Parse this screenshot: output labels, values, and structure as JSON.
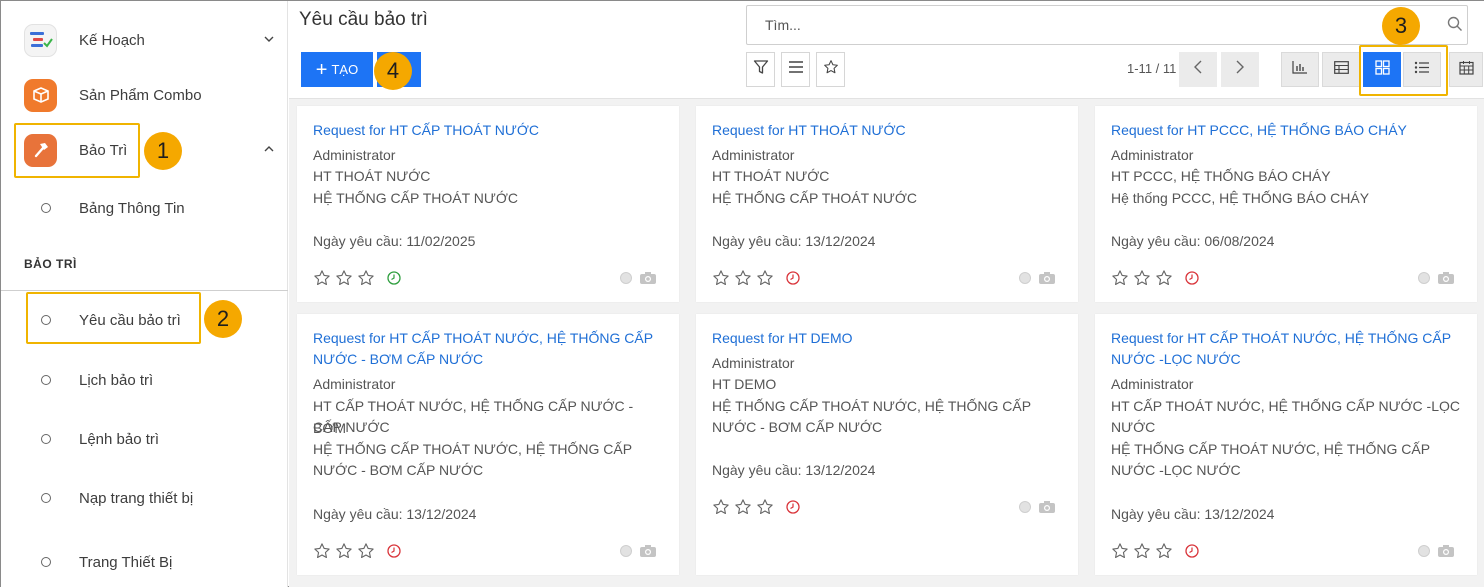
{
  "sidebar": {
    "apps": [
      {
        "label": "Kế Hoạch",
        "icon": "plan-chart-icon"
      },
      {
        "label": "Sản Phẩm Combo",
        "icon": "combo-box-icon"
      },
      {
        "label": "Bảo Trì",
        "icon": "hammer-icon"
      }
    ],
    "maintenance_sub": {
      "label": "Bảng Thông Tin"
    },
    "section_header": "BẢO TRÌ",
    "items": [
      {
        "label": "Yêu cầu bảo trì"
      },
      {
        "label": "Lịch bảo trì"
      },
      {
        "label": "Lệnh bảo trì"
      },
      {
        "label": "Nạp trang thiết bị"
      },
      {
        "label": "Trang Thiết Bị"
      }
    ]
  },
  "badges": {
    "b1": "1",
    "b2": "2",
    "b3": "3",
    "b4": "4"
  },
  "header": {
    "title": "Yêu cầu bảo trì",
    "search_placeholder": "Tìm...",
    "create_label": "TẠO",
    "pager": "1-11 / 11"
  },
  "colors": {
    "accent": "#1d74f5",
    "highlight": "#f0b400",
    "badge": "#f5a800",
    "clock_green": "#2e9e3e",
    "clock_red": "#d9343a"
  },
  "cards": [
    {
      "title": "Request for HT CẤP THOÁT NƯỚC",
      "lines": [
        "Administrator",
        "HT THOÁT NƯỚC",
        "HỆ THỐNG CẤP THOÁT NƯỚC"
      ],
      "date": "Ngày yêu cầu: 11/02/2025",
      "clock": "green"
    },
    {
      "title": "Request for HT THOÁT NƯỚC",
      "lines": [
        "Administrator",
        "HT THOÁT NƯỚC",
        "HỆ THỐNG CẤP THOÁT NƯỚC"
      ],
      "date": "Ngày yêu cầu: 13/12/2024",
      "clock": "red"
    },
    {
      "title": "Request for HT PCCC, HỆ THỐNG BÁO CHÁY",
      "lines": [
        "Administrator",
        "HT PCCC, HỆ THỐNG BÁO CHÁY",
        "Hệ thống PCCC, HỆ THỐNG BÁO CHÁY"
      ],
      "date": "Ngày yêu cầu: 06/08/2024",
      "clock": "red"
    },
    {
      "title_lines": [
        "Request for HT CẤP THOÁT NƯỚC, HỆ THỐNG CẤP",
        "NƯỚC - BƠM CẤP NƯỚC"
      ],
      "lines": [
        "Administrator",
        "HT CẤP THOÁT NƯỚC, HỆ THỐNG CẤP NƯỚC - BƠM",
        "CẤP NƯỚC",
        "HỆ THỐNG CẤP THOÁT NƯỚC, HỆ THỐNG CẤP",
        "NƯỚC - BƠM CẤP NƯỚC"
      ],
      "date": "Ngày yêu cầu: 13/12/2024",
      "clock": "red"
    },
    {
      "title": "Request for HT DEMO",
      "lines": [
        "Administrator",
        "HT DEMO",
        "HỆ THỐNG CẤP THOÁT NƯỚC, HỆ THỐNG CẤP",
        "NƯỚC - BƠM CẤP NƯỚC"
      ],
      "date": "Ngày yêu cầu: 13/12/2024",
      "clock": "red"
    },
    {
      "title_lines": [
        "Request for HT CẤP THOÁT NƯỚC, HỆ THỐNG CẤP",
        "NƯỚC -LỌC NƯỚC"
      ],
      "lines": [
        "Administrator",
        "HT CẤP THOÁT NƯỚC, HỆ THỐNG CẤP NƯỚC -LỌC",
        "NƯỚC",
        "HỆ THỐNG CẤP THOÁT NƯỚC, HỆ THỐNG CẤP",
        "NƯỚC -LỌC NƯỚC"
      ],
      "date": "Ngày yêu cầu: 13/12/2024",
      "clock": "red"
    }
  ]
}
